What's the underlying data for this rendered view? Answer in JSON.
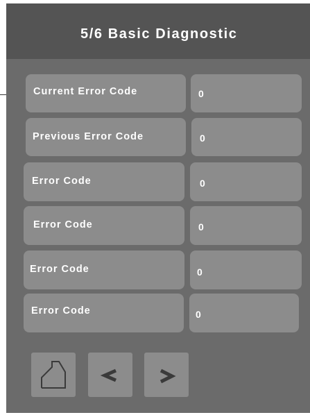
{
  "header": {
    "title": "5/6 Basic Diagnostic"
  },
  "rows": [
    {
      "label": "Current Error Code",
      "value": "0"
    },
    {
      "label": "Previous Error Code",
      "value": "0"
    },
    {
      "label": "Error Code",
      "value": "0"
    },
    {
      "label": "Error Code",
      "value": "0"
    },
    {
      "label": "Error Code",
      "value": "0"
    },
    {
      "label": "Error Code",
      "value": "0"
    }
  ],
  "nav": {
    "home_icon": "home-icon",
    "back_icon": "chevron-left-icon",
    "next_icon": "chevron-right-icon"
  },
  "colors": {
    "header": "#545454",
    "panel": "#6b6b6b",
    "button": "#8c8c8c",
    "text": "#ffffff"
  }
}
